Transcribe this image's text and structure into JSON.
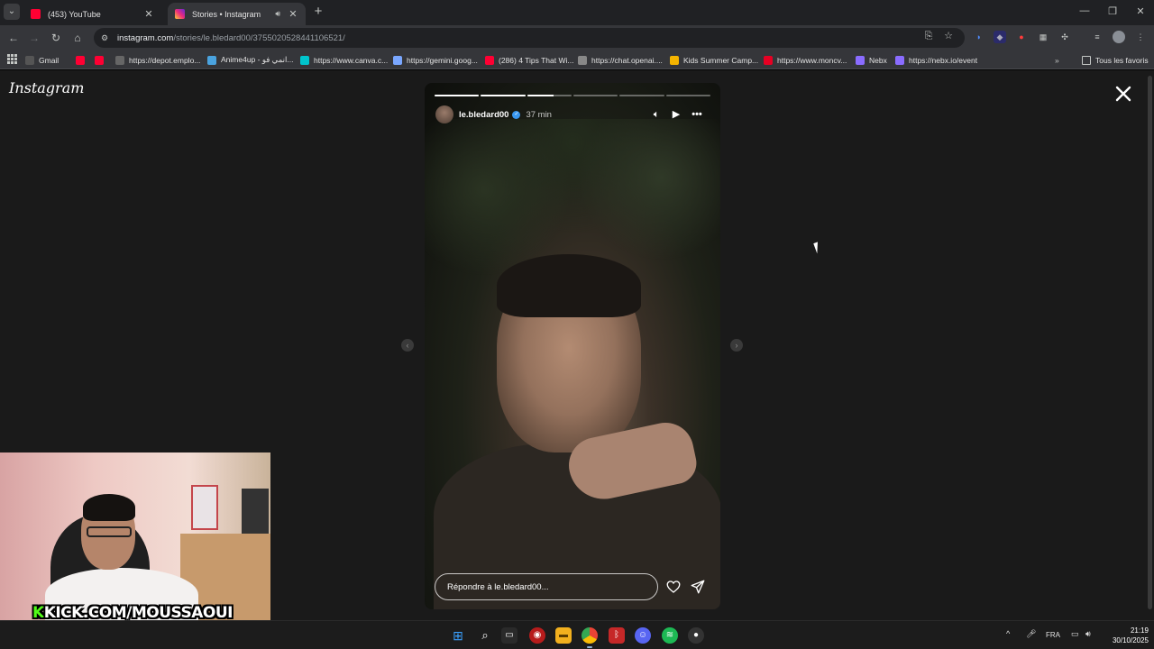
{
  "browser": {
    "tabs": [
      {
        "title": "(453) YouTube",
        "favicon": "youtube-icon",
        "color": "#ff0033",
        "active": false
      },
      {
        "title": "Stories • Instagram",
        "favicon": "instagram-icon",
        "color": "#c13584",
        "active": true
      }
    ],
    "url_host": "instagram.com",
    "url_path": "/stories/le.bledard00/3755020528441106521/",
    "bookmarks": [
      {
        "label": "Gmail",
        "icon": "gmail-icon",
        "color": "#555"
      },
      {
        "label": "",
        "icon": "youtube-icon",
        "color": "#ff0033"
      },
      {
        "label": "",
        "icon": "youtube-icon",
        "color": "#ff0033"
      },
      {
        "label": "https://depot.emplo...",
        "icon": "globe-icon",
        "color": "#666"
      },
      {
        "label": "Anime4up - انمي فو...",
        "icon": "anime4up-icon",
        "color": "#4aa3df"
      },
      {
        "label": "https://www.canva.c...",
        "icon": "canva-icon",
        "color": "#00c4cc"
      },
      {
        "label": "https://gemini.goog...",
        "icon": "gemini-icon",
        "color": "#7aa7ff"
      },
      {
        "label": "(286) 4 Tips That Wi...",
        "icon": "youtube-icon",
        "color": "#ff0033"
      },
      {
        "label": "https://chat.openai....",
        "icon": "openai-icon",
        "color": "#888"
      },
      {
        "label": "Kids Summer Camp...",
        "icon": "bookmark-site-icon",
        "color": "#f4b400"
      },
      {
        "label": "https://www.moncv...",
        "icon": "pinterest-icon",
        "color": "#e60023"
      },
      {
        "label": "Nebx",
        "icon": "nebx-icon",
        "color": "#8a6cff"
      },
      {
        "label": "https://nebx.io/event",
        "icon": "nebx-icon",
        "color": "#8a6cff"
      }
    ],
    "all_bookmarks_label": "Tous les favoris"
  },
  "instagram": {
    "logo": "Instagram",
    "story": {
      "username": "le.bledard00",
      "time_ago": "37 min",
      "reply_placeholder": "Répondre à le.bledard00...",
      "segments": [
        1,
        1,
        0.6,
        0,
        0,
        0
      ]
    }
  },
  "webcam": {
    "brand_k": "K",
    "brand_text": "KICK.COM/MOUSSAOUI"
  },
  "taskbar": {
    "language": "FRA",
    "time": "21:19",
    "date": "30/10/2025",
    "apps": [
      "windows-start-icon",
      "search-icon",
      "task-view-icon",
      "app-icon",
      "file-explorer-icon",
      "chrome-icon",
      "app-icon",
      "discord-icon",
      "spotify-icon",
      "app-icon"
    ]
  }
}
